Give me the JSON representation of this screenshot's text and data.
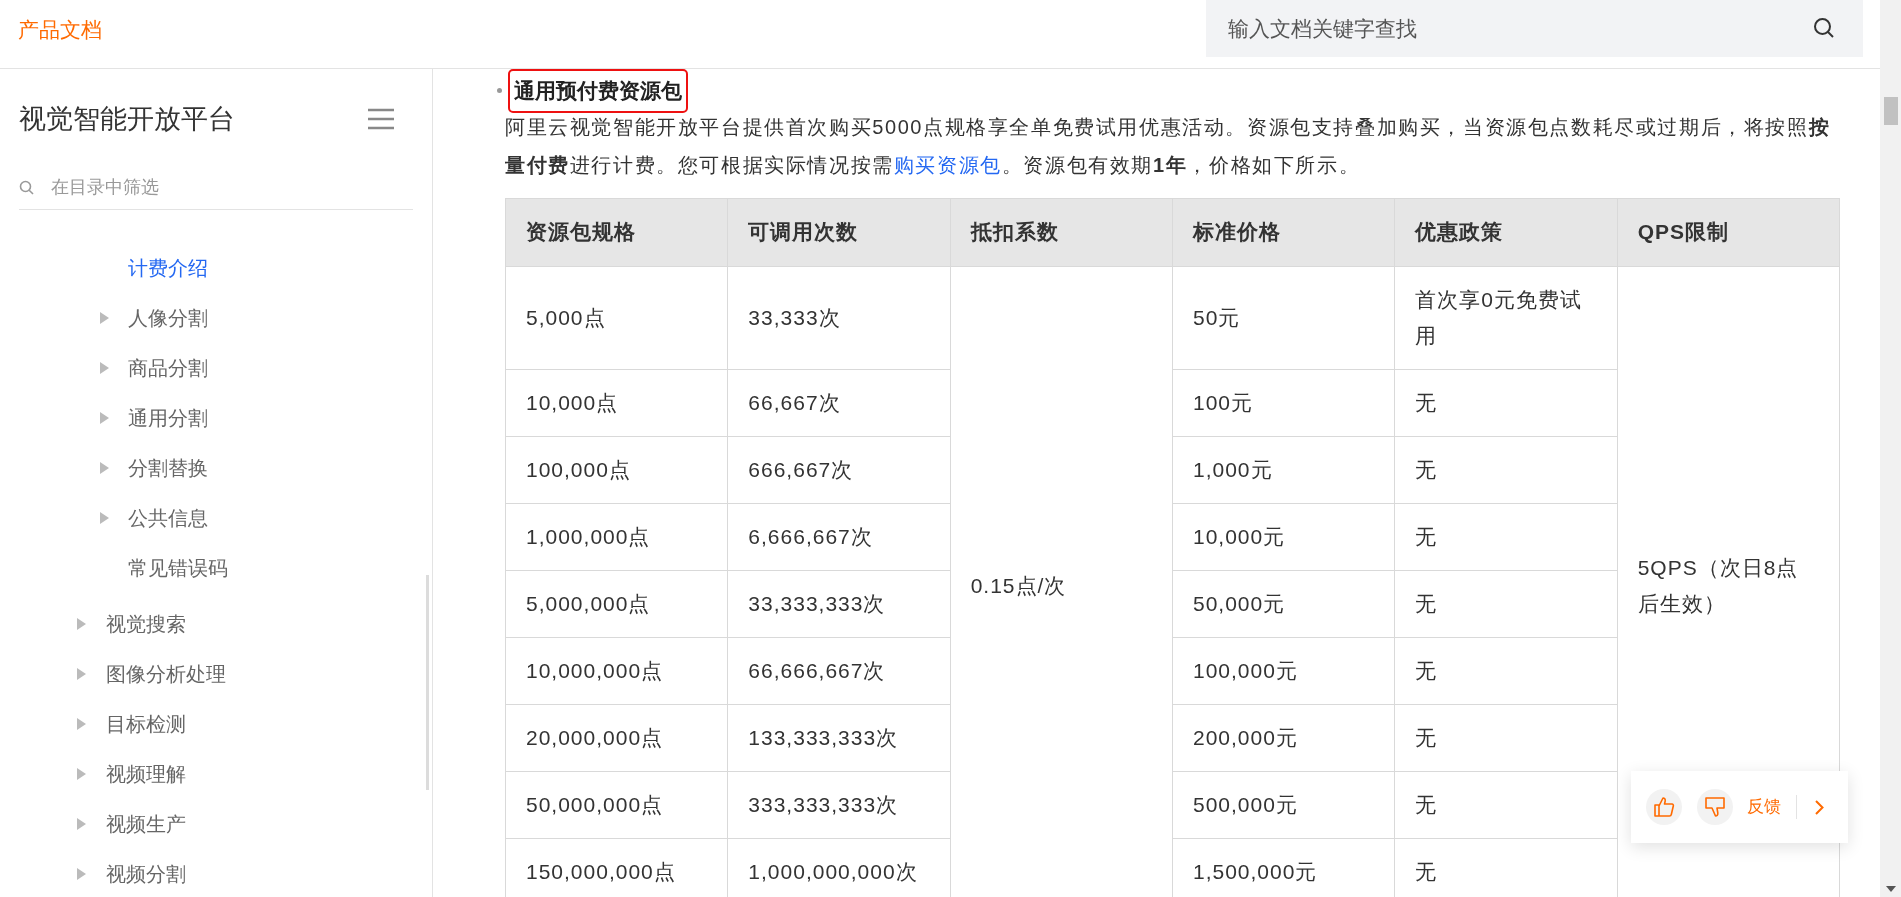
{
  "header": {
    "title": "产品文档",
    "search": {
      "placeholder": "输入文档关键字查找"
    }
  },
  "sidebar": {
    "title": "视觉智能开放平台",
    "filter": {
      "placeholder": "在目录中筛选"
    },
    "nested_items": [
      {
        "label": "计费介绍",
        "expandable": false,
        "selected": true
      },
      {
        "label": "人像分割",
        "expandable": true,
        "selected": false
      },
      {
        "label": "商品分割",
        "expandable": true,
        "selected": false
      },
      {
        "label": "通用分割",
        "expandable": true,
        "selected": false
      },
      {
        "label": "分割替换",
        "expandable": true,
        "selected": false
      },
      {
        "label": "公共信息",
        "expandable": true,
        "selected": false
      },
      {
        "label": "常见错误码",
        "expandable": false,
        "selected": false
      }
    ],
    "items": [
      {
        "label": "视觉搜索",
        "expandable": true,
        "selected": false
      },
      {
        "label": "图像分析处理",
        "expandable": true,
        "selected": false
      },
      {
        "label": "目标检测",
        "expandable": true,
        "selected": false
      },
      {
        "label": "视频理解",
        "expandable": true,
        "selected": false
      },
      {
        "label": "视频生产",
        "expandable": true,
        "selected": false
      },
      {
        "label": "视频分割",
        "expandable": true,
        "selected": false
      }
    ]
  },
  "content": {
    "heading": {
      "text": "通用预付费资源包",
      "highlighted": true
    },
    "paragraph": [
      {
        "kind": "text",
        "text": "阿里云视觉智能开放平台提供首次购买5000点规格享全单免费试用优惠活动。资源包支持叠加购买，当资源包点数耗尽或过期后，将按照**按量付费**进行计费。您可根据实际情况按需"
      },
      {
        "kind": "link",
        "text": "购买资源包"
      },
      {
        "kind": "text",
        "text": "。资源包有效期**1年**，价格如下所示。"
      }
    ],
    "table": {
      "columns": [
        "资源包规格",
        "可调用次数",
        "抵扣系数",
        "标准价格",
        "优惠政策",
        "QPS限制"
      ],
      "merged": {
        "deduction": "0.15点/次",
        "qps": "5QPS（次日8点后生效）"
      },
      "rows": [
        {
          "spec": "5,000点",
          "calls": "33,333次",
          "price": "50元",
          "offer": "首次享0元免费试用"
        },
        {
          "spec": "10,000点",
          "calls": "66,667次",
          "price": "100元",
          "offer": "无"
        },
        {
          "spec": "100,000点",
          "calls": "666,667次",
          "price": "1,000元",
          "offer": "无"
        },
        {
          "spec": "1,000,000点",
          "calls": "6,666,667次",
          "price": "10,000元",
          "offer": "无"
        },
        {
          "spec": "5,000,000点",
          "calls": "33,333,333次",
          "price": "50,000元",
          "offer": "无"
        },
        {
          "spec": "10,000,000点",
          "calls": "66,666,667次",
          "price": "100,000元",
          "offer": "无"
        },
        {
          "spec": "20,000,000点",
          "calls": "133,333,333次",
          "price": "200,000元",
          "offer": "无"
        },
        {
          "spec": "50,000,000点",
          "calls": "333,333,333次",
          "price": "500,000元",
          "offer": "无"
        },
        {
          "spec": "150,000,000点",
          "calls": "1,000,000,000次",
          "price": "1,500,000元",
          "offer": "无"
        }
      ]
    }
  },
  "feedback": {
    "label": "反馈"
  }
}
